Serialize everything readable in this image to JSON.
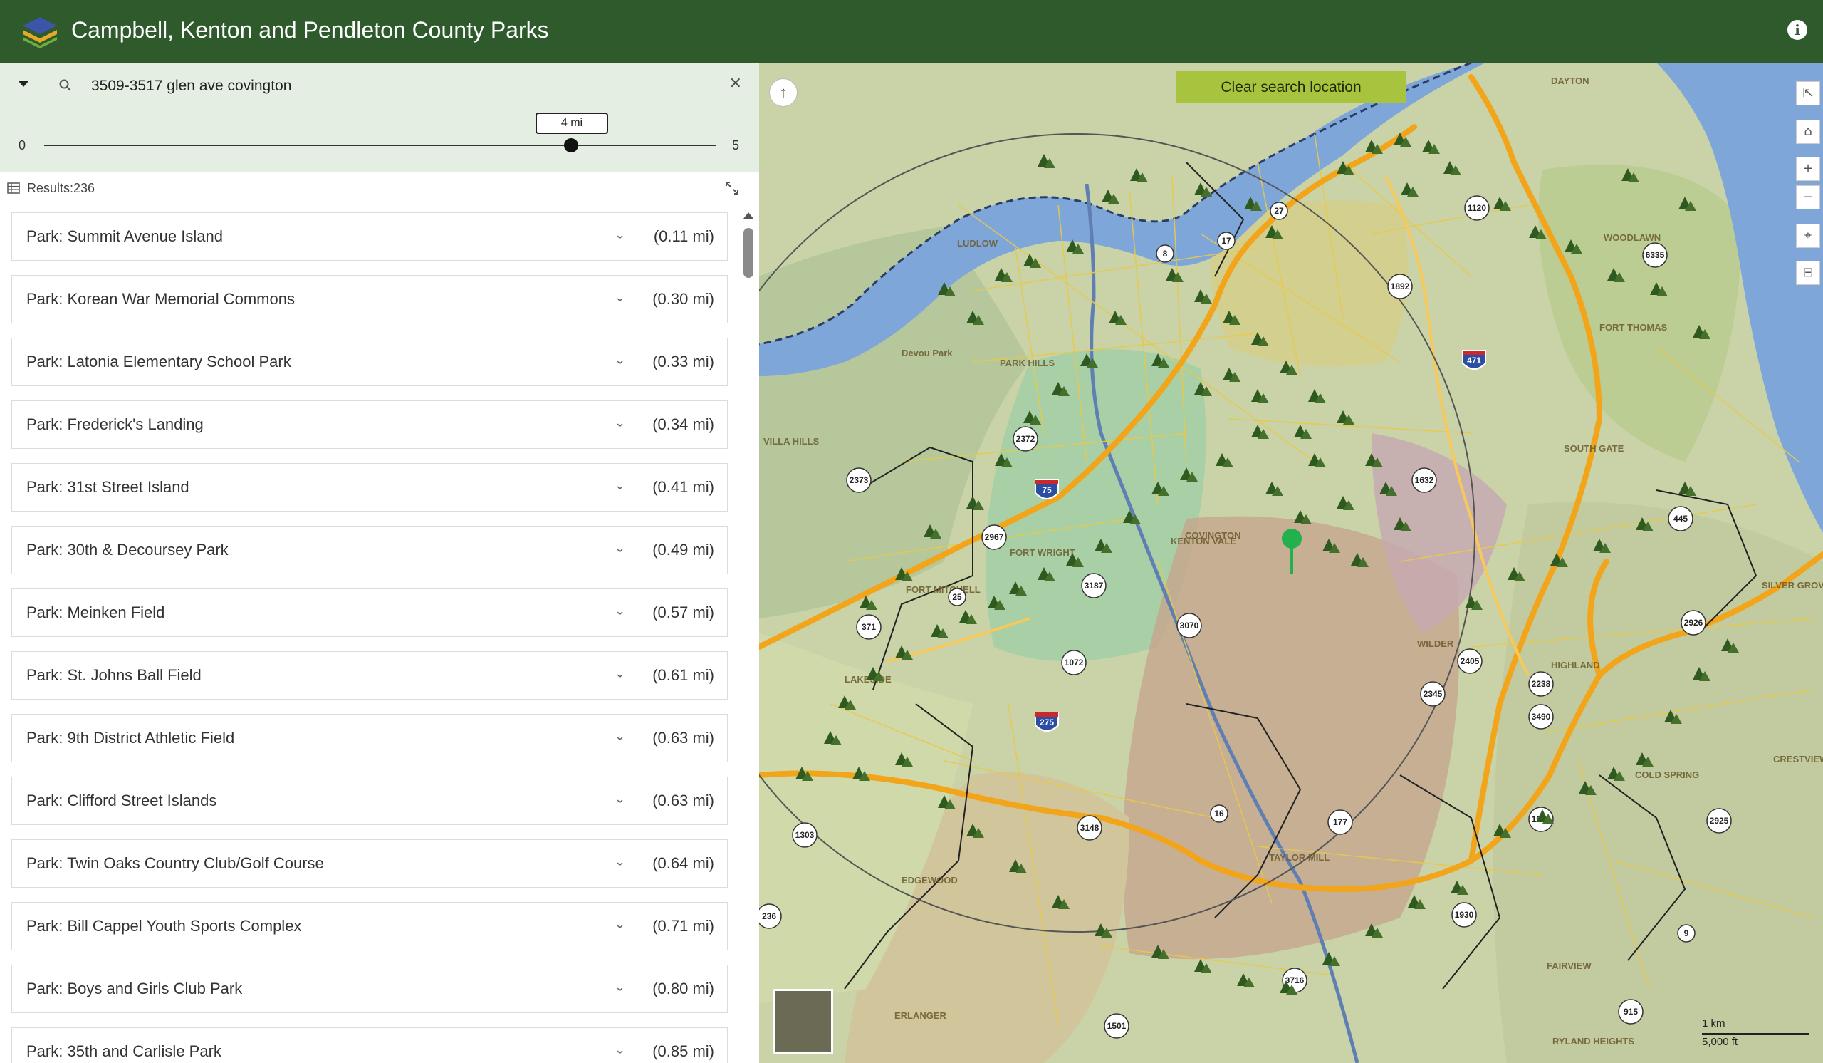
{
  "app": {
    "title": "Campbell, Kenton and Pendleton County Parks",
    "info_icon": "info-icon"
  },
  "search": {
    "value": "3509-3517 glen ave covington",
    "placeholder": ""
  },
  "radius": {
    "min": "0",
    "max": "5",
    "value_label": "4 mi",
    "value": 4
  },
  "results": {
    "label": "Results:236"
  },
  "parks": [
    {
      "name": "Park: Summit Avenue Island",
      "distance": "(0.11 mi)"
    },
    {
      "name": "Park: Korean War Memorial Commons",
      "distance": "(0.30 mi)"
    },
    {
      "name": "Park: Latonia Elementary School Park",
      "distance": "(0.33 mi)"
    },
    {
      "name": "Park: Frederick's Landing",
      "distance": "(0.34 mi)"
    },
    {
      "name": "Park: 31st Street Island",
      "distance": "(0.41 mi)"
    },
    {
      "name": "Park: 30th & Decoursey Park",
      "distance": "(0.49 mi)"
    },
    {
      "name": "Park: Meinken Field",
      "distance": "(0.57 mi)"
    },
    {
      "name": "Park: St. Johns Ball Field",
      "distance": "(0.61 mi)"
    },
    {
      "name": "Park: 9th District Athletic Field",
      "distance": "(0.63 mi)"
    },
    {
      "name": "Park: Clifford Street Islands",
      "distance": "(0.63 mi)"
    },
    {
      "name": "Park: Twin Oaks Country Club/Golf Course",
      "distance": "(0.64 mi)"
    },
    {
      "name": "Park: Bill Cappel Youth Sports Complex",
      "distance": "(0.71 mi)"
    },
    {
      "name": "Park: Boys and Girls Club Park",
      "distance": "(0.80 mi)"
    },
    {
      "name": "Park: 35th and Carlisle Park",
      "distance": "(0.85 mi)"
    }
  ],
  "map": {
    "clear_search_label": "Clear search location",
    "place_labels": [
      "DAYTON",
      "COVINGTON",
      "FORT THOMAS",
      "SOUTH GATE",
      "FORT WRIGHT",
      "FORT MITCHELL",
      "KENTON VALE",
      "LUDLOW",
      "PARK HILLS",
      "VILLA HILLS",
      "EDGEWOOD",
      "ERLANGER",
      "TAYLOR MILL",
      "FAIRVIEW",
      "RYLAND HEIGHTS",
      "COLD SPRING",
      "SILVER GROVE",
      "CRESTVIEW",
      "HIGHLAND",
      "WILDER",
      "LAKESIDE",
      "Devou Park",
      "WOODLAWN"
    ],
    "route_shields": [
      "75",
      "275",
      "471",
      "27",
      "8",
      "17",
      "1120",
      "6335",
      "1892",
      "1632",
      "445",
      "2372",
      "2373",
      "2967",
      "3187",
      "3070",
      "1072",
      "371",
      "25",
      "2405",
      "2345",
      "2238",
      "3490",
      "2926",
      "1998",
      "2925",
      "1303",
      "3148",
      "177",
      "16",
      "3716",
      "1930",
      "1501",
      "236",
      "915",
      "9"
    ],
    "scale_top": "1 km",
    "scale_bottom": "5,000 ft",
    "colors": {
      "header": "#2f5a2c",
      "button": "#a8c43e",
      "highway": "#f2a51a",
      "water": "#7ea6d8"
    }
  }
}
